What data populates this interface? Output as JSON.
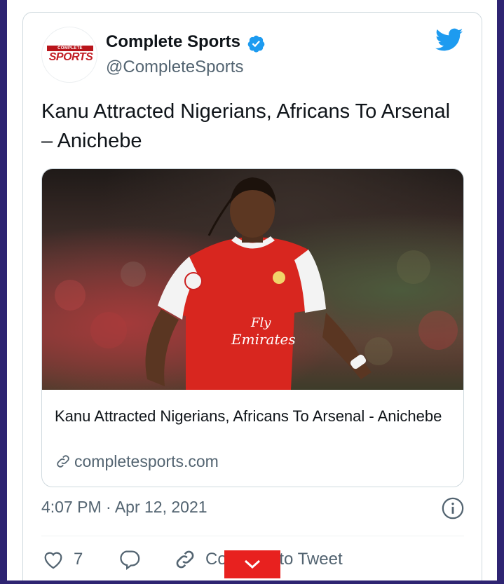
{
  "account": {
    "name": "Complete Sports",
    "handle": "@CompleteSports",
    "avatar_logo_top": "COMPLETE",
    "avatar_logo_main": "SPORTS",
    "verified": true
  },
  "tweet": {
    "text": "Kanu Attracted Nigerians, Africans To Arsenal – Anichebe",
    "timestamp": "4:07 PM · Apr 12, 2021"
  },
  "link_card": {
    "title": "Kanu Attracted Nigerians, Africans To Arsenal - Anichebe",
    "domain": "completesports.com",
    "image_alt": "Footballer in red and white Arsenal kit on pitch"
  },
  "actions": {
    "like_count": "7",
    "copy_label": "Copy link to Tweet"
  },
  "icons": {
    "brand": "twitter-bird-icon",
    "verified": "verified-badge-icon",
    "link": "link-icon",
    "info": "info-icon",
    "like": "heart-icon",
    "reply": "reply-bubble-icon",
    "copy": "link-icon",
    "overlay": "chevron-down-icon"
  },
  "colors": {
    "twitter_blue": "#1d9bf0",
    "text_primary": "#0f1419",
    "text_secondary": "#536471",
    "overlay_red": "#e8211f",
    "frame": "#2e2472"
  }
}
